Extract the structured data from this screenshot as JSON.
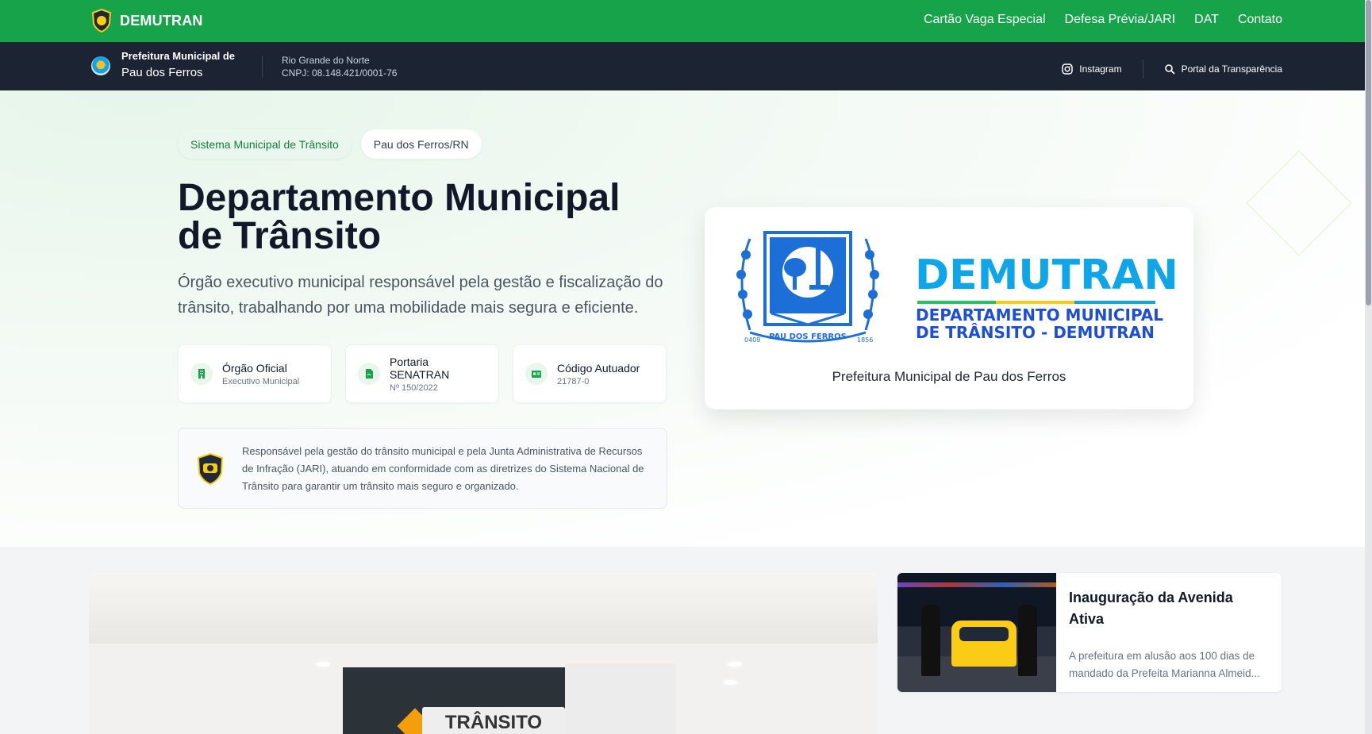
{
  "topbar": {
    "brand": "DEMUTRAN",
    "nav": [
      "Cartão Vaga Especial",
      "Defesa Prévia/JARI",
      "DAT",
      "Contato"
    ]
  },
  "subbar": {
    "pref_line1": "Prefeitura Municipal de",
    "pref_line2": "Pau dos Ferros",
    "state": "Rio Grande do Norte",
    "cnpj": "CNPJ: 08.148.421/0001-76",
    "links": {
      "instagram": "Instagram",
      "transparency": "Portal da Transparência"
    }
  },
  "hero": {
    "pills": [
      "Sistema Municipal de Trânsito",
      "Pau dos Ferros/RN"
    ],
    "title": "Departamento Municipal de Trânsito",
    "description": "Órgão executivo municipal responsável pela gestão e fiscalização do trânsito, trabalhando por uma mobilidade mais segura e eficiente.",
    "cards": [
      {
        "title": "Órgão Oficial",
        "sub": "Executivo Municipal",
        "icon": "building-icon"
      },
      {
        "title": "Portaria SENATRAN",
        "sub": "Nº 150/2022",
        "icon": "document-icon"
      },
      {
        "title": "Código Autuador",
        "sub": "21787-0",
        "icon": "id-card-icon"
      }
    ],
    "info": "Responsável pela gestão do trânsito municipal e pela Junta Administrativa de Recursos de Infração (JARI), atuando em conformidade com as diretrizes do Sistema Nacional de Trânsito para garantir um trânsito mais seguro e organizado.",
    "logo": {
      "word": "DEMUTRAN",
      "line1": "DEPARTAMENTO MUNICIPAL",
      "line2": "DE TRÂNSITO - DEMUTRAN",
      "crest_banner": "PAU DOS FERROS",
      "crest_left_year": "0409",
      "crest_right_year": "1856",
      "caption": "Prefeitura Municipal de Pau dos Ferros"
    }
  },
  "news": {
    "main_sign": "TRÂNSITO",
    "card": {
      "title": "Inauguração da Avenida Ativa",
      "desc": "A prefeitura em alusão aos 100 dias de mandado da Prefeita Marianna Almeid..."
    }
  },
  "colors": {
    "topbar": "#16a34a",
    "subbar": "#1c2333",
    "brand_blue": "#0ea5e9",
    "dark_blue": "#1d4ed8"
  }
}
